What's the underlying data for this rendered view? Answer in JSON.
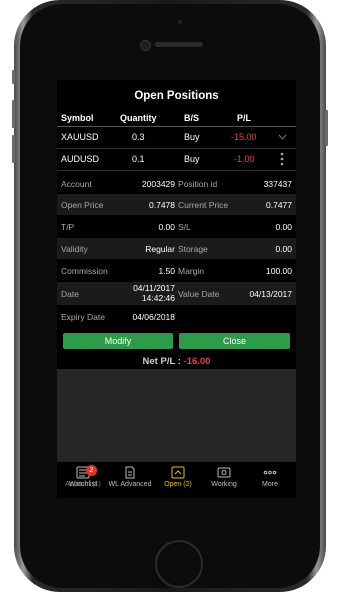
{
  "screen": {
    "title": "Open Positions"
  },
  "columns": [
    "Symbol",
    "Quantity",
    "B/S",
    "P/L"
  ],
  "positions": [
    {
      "symbol": "XAUUSD",
      "quantity": "0.3",
      "side": "Buy",
      "pl": "-15.00"
    },
    {
      "symbol": "AUDUSD",
      "quantity": "0.1",
      "side": "Buy",
      "pl": "-1.00"
    }
  ],
  "details": {
    "account_label": "Account",
    "account": "2003429",
    "position_id_label": "Position id",
    "position_id": "337437",
    "open_price_label": "Open Price",
    "open_price": "0.7478",
    "current_price_label": "Current Price",
    "current_price": "0.7477",
    "tp_label": "T/P",
    "tp": "0.00",
    "sl_label": "S/L",
    "sl": "0.00",
    "validity_label": "Validity",
    "validity": "Regular",
    "storage_label": "Storage",
    "storage": "0.00",
    "commission_label": "Commission",
    "commission": "1.50",
    "margin_label": "Margin",
    "margin": "100.00",
    "date_label": "Date",
    "date_line1": "04/11/2017",
    "date_line2": "14:42:46",
    "value_date_label": "Value Date",
    "value_date": "04/13/2017",
    "expiry_date_label": "Expiry Date",
    "expiry_date": "04/06/2018"
  },
  "actions": {
    "modify": "Modify",
    "close": "Close"
  },
  "net_pl": {
    "label": "Net P/L :",
    "value": "-16.00"
  },
  "tabbar": {
    "tab1_label": "Watchlist",
    "tab1_overlap": "Account (1)",
    "tab1_badge": "2",
    "tab2_label": "WL Advanced",
    "tab3_label": "Open (2)",
    "tab4_label": "Working",
    "tab5_label": "More"
  },
  "colors": {
    "accent_green": "#2f9a4a",
    "negative": "#e0423a",
    "active_tab": "#e8b640"
  }
}
